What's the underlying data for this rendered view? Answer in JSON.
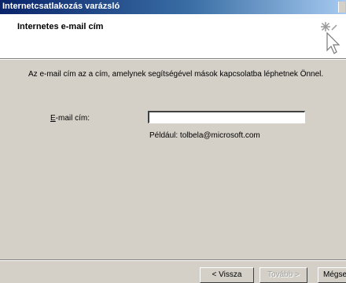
{
  "window": {
    "title": "Internetcsatlakozás varázsló"
  },
  "header": {
    "title": "Internetes e-mail cím",
    "icon": "wizard-cursor-icon"
  },
  "content": {
    "intro": "Az e-mail cím az a cím, amelynek segítségével mások kapcsolatba léphetnek Önnel.",
    "email_label_accel": "E",
    "email_label_rest": "-mail cím:",
    "email_value": "",
    "example": "Például: tolbela@microsoft.com"
  },
  "buttons": {
    "back": "< Vissza",
    "next": "Tovább >",
    "cancel": "Mégse"
  }
}
